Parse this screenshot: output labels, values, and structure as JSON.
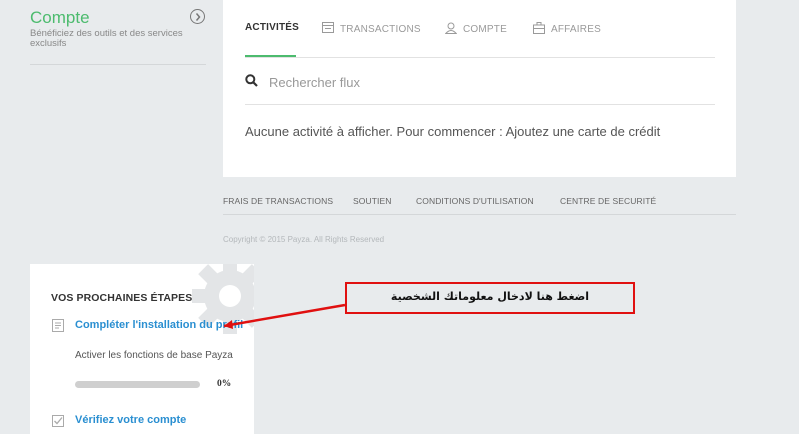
{
  "sidebar": {
    "compte_title": "Compte",
    "compte_desc": "Bénéficiez des outils et des services exclusifs"
  },
  "tabs": [
    {
      "label": "ACTIVITÉS",
      "icon": "none",
      "active": true
    },
    {
      "label": "TRANSACTIONS",
      "icon": "receipt-icon"
    },
    {
      "label": "COMPTE",
      "icon": "user-icon"
    },
    {
      "label": "AFFAIRES",
      "icon": "briefcase-icon"
    }
  ],
  "search": {
    "placeholder": "Rechercher flux",
    "value": ""
  },
  "activity": {
    "empty_message": "Aucune activité à afficher. Pour commencer : Ajoutez une carte de crédit"
  },
  "footer": {
    "links": [
      "FRAIS DE TRANSACTIONS",
      "SOUTIEN",
      "CONDITIONS D'UTILISATION",
      "CENTRE DE SECURITÉ"
    ],
    "copyright": "Copyright © 2015 Payza. All Rights Reserved"
  },
  "next_steps": {
    "title": "VOS PROCHAINES ÉTAPES",
    "step1": {
      "link": "Compléter l'installation du profil",
      "desc": "Activer les fonctions de base Payza",
      "progress": 0,
      "progress_label": "0%"
    },
    "step2": {
      "link": "Vérifiez votre compte"
    }
  },
  "annotation": {
    "text": "اضغط هنا لادخال معلوماتك الشخصية",
    "color": "#e01010"
  },
  "colors": {
    "accent": "#4cbb6e",
    "link": "#2a8fd1",
    "background": "#e8ebed"
  }
}
